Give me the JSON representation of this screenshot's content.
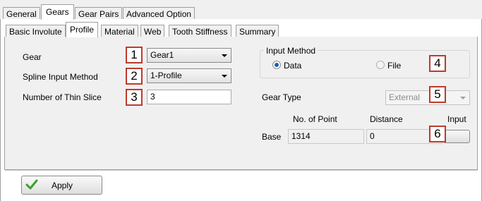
{
  "main_tabs": [
    {
      "label": "General"
    },
    {
      "label": "Gears"
    },
    {
      "label": "Gear Pairs"
    },
    {
      "label": "Advanced Option"
    }
  ],
  "sub_tabs": [
    {
      "label": "Basic Involute"
    },
    {
      "label": "Profile"
    },
    {
      "label": "Material"
    },
    {
      "label": "Web"
    },
    {
      "label": "Tooth Stiffness"
    },
    {
      "label": "Summary"
    }
  ],
  "form": {
    "gear_label": "Gear",
    "gear_value": "Gear1",
    "spline_label": "Spline Input Method",
    "spline_value": "1-Profile",
    "thin_slice_label": "Number of Thin Slice",
    "thin_slice_value": "3"
  },
  "input_method": {
    "title": "Input Method",
    "option_data": "Data",
    "option_file": "File",
    "selected": "Data"
  },
  "gear_type": {
    "label": "Gear Type",
    "value": "External"
  },
  "table": {
    "headers": [
      "No. of Point",
      "Distance",
      "Input"
    ],
    "row_label": "Base",
    "points": "1314",
    "distance": "0"
  },
  "callouts": [
    "1",
    "2",
    "3",
    "4",
    "5",
    "6"
  ],
  "apply_label": "Apply",
  "colors": {
    "callout_border": "#c0392b",
    "radio_selected": "#1a5fb4",
    "apply_check": "#3aa12f"
  }
}
